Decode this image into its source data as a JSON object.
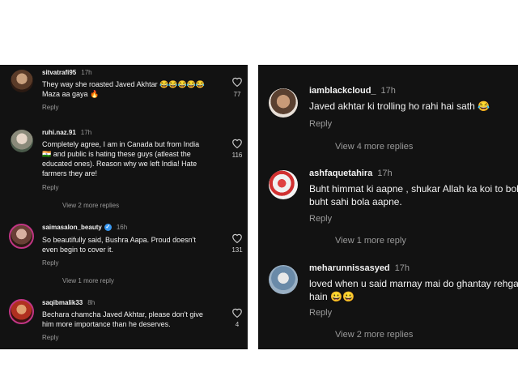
{
  "left_comments": [
    {
      "user": "sitvatrafi95",
      "time": "17h",
      "text": "They way she roasted Javed Akhtar 😂😂😂😂😂 Maza aa gaya 🔥",
      "reply": "Reply",
      "likes": "77",
      "more": ""
    },
    {
      "user": "ruhi.naz.91",
      "time": "17h",
      "text": "Completely agree, I am in Canada but from India 🇮🇳 and public is hating these guys (atleast the educated ones). Reason why we left India! Hate farmers they are!",
      "reply": "Reply",
      "likes": "116",
      "more": "View 2 more replies"
    },
    {
      "user": "saimasalon_beauty",
      "time": "16h",
      "verified": true,
      "text": "So beautifully said, Bushra Aapa. Proud doesn't even begin to cover it.",
      "reply": "Reply",
      "likes": "131",
      "more": "View 1 more reply"
    },
    {
      "user": "saqibmalik33",
      "time": "8h",
      "text": "Bechara chamcha Javed Akhtar, please don't give him more importance than he deserves.",
      "reply": "Reply",
      "likes": "4",
      "more": ""
    }
  ],
  "right_comments": [
    {
      "user": "iamblackcloud_",
      "time": "17h",
      "text": "Javed akhtar ki trolling ho rahi hai sath 😂",
      "reply": "Reply",
      "more": "View 4 more replies"
    },
    {
      "user": "ashfaquetahira",
      "time": "17h",
      "text": "Buht himmat ki aapne , shukar Allah ka koi to bola. buht sahi bola aapne.",
      "reply": "Reply",
      "more": "View 1 more reply"
    },
    {
      "user": "meharunnissasyed",
      "time": "17h",
      "text": "loved when u said marnay mai do ghantay rehgay hain 😀😀",
      "reply": "Reply",
      "more": "View 2 more replies"
    }
  ]
}
